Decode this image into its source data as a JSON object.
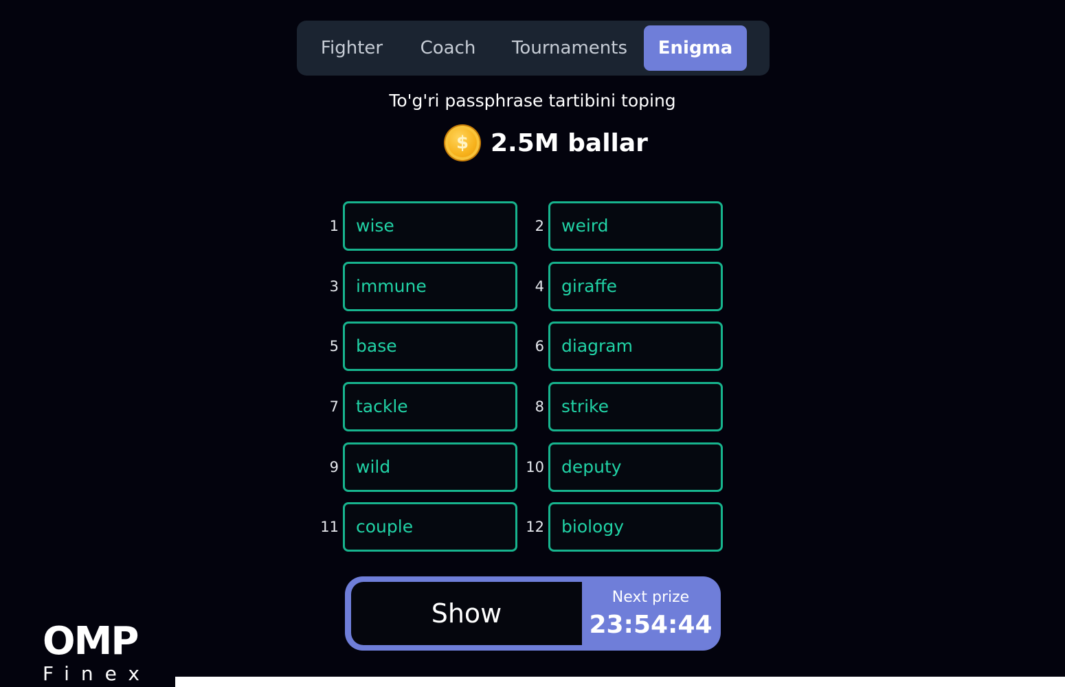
{
  "tabs": {
    "fighter": "Fighter",
    "coach": "Coach",
    "tournaments": "Tournaments",
    "enigma": "Enigma",
    "active": "Enigma"
  },
  "header": {
    "subtitle": "To'g'ri passphrase tartibini toping",
    "coin_symbol": "$",
    "prize": "2.5M ballar"
  },
  "words": [
    {
      "num": "1",
      "word": "wise"
    },
    {
      "num": "2",
      "word": "weird"
    },
    {
      "num": "3",
      "word": "immune"
    },
    {
      "num": "4",
      "word": "giraffe"
    },
    {
      "num": "5",
      "word": "base"
    },
    {
      "num": "6",
      "word": "diagram"
    },
    {
      "num": "7",
      "word": "tackle"
    },
    {
      "num": "8",
      "word": "strike"
    },
    {
      "num": "9",
      "word": "wild"
    },
    {
      "num": "10",
      "word": "deputy"
    },
    {
      "num": "11",
      "word": "couple"
    },
    {
      "num": "12",
      "word": "biology"
    }
  ],
  "action": {
    "show_label": "Show",
    "next_prize_label": "Next prize",
    "timer": "23:54:44"
  },
  "logo": {
    "main": "OMP",
    "sub": "Finex"
  },
  "colors": {
    "background": "#03030d",
    "tabbar": "#1b2431",
    "accent": "#6f7ed9",
    "word_border": "#17b48e",
    "word_text": "#21d3a6",
    "coin": "#f7b21c"
  }
}
